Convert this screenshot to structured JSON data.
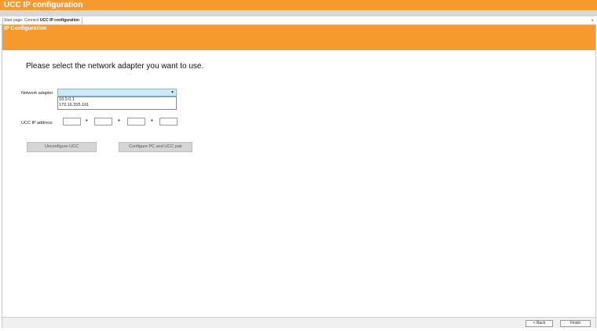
{
  "window": {
    "title": "UCC IP configuration"
  },
  "breadcrumb": {
    "prefix": "Start page: Connect",
    "current": "UCC IP configuration"
  },
  "panel": {
    "title": "IP Configuration",
    "close_glyph": "×"
  },
  "main": {
    "instruction": "Please select the network adapter you want to use.",
    "network_adapter_label": "Network adapter",
    "adapter_options": [
      "10.0.0.1",
      "172.16.205.161"
    ],
    "ucc_ip_label": "UCC IP address",
    "ip_octets": [
      "",
      "",
      "",
      ""
    ],
    "ip_separator": "•",
    "unconfigure_label": "Unconfigure UCC",
    "configure_label": "Configure PC and UCC pair"
  },
  "footer": {
    "back_label": "< Back",
    "finish_label": "Finish"
  },
  "colors": {
    "accent": "#f79a2e",
    "combo_bg": "#cde8f7"
  }
}
